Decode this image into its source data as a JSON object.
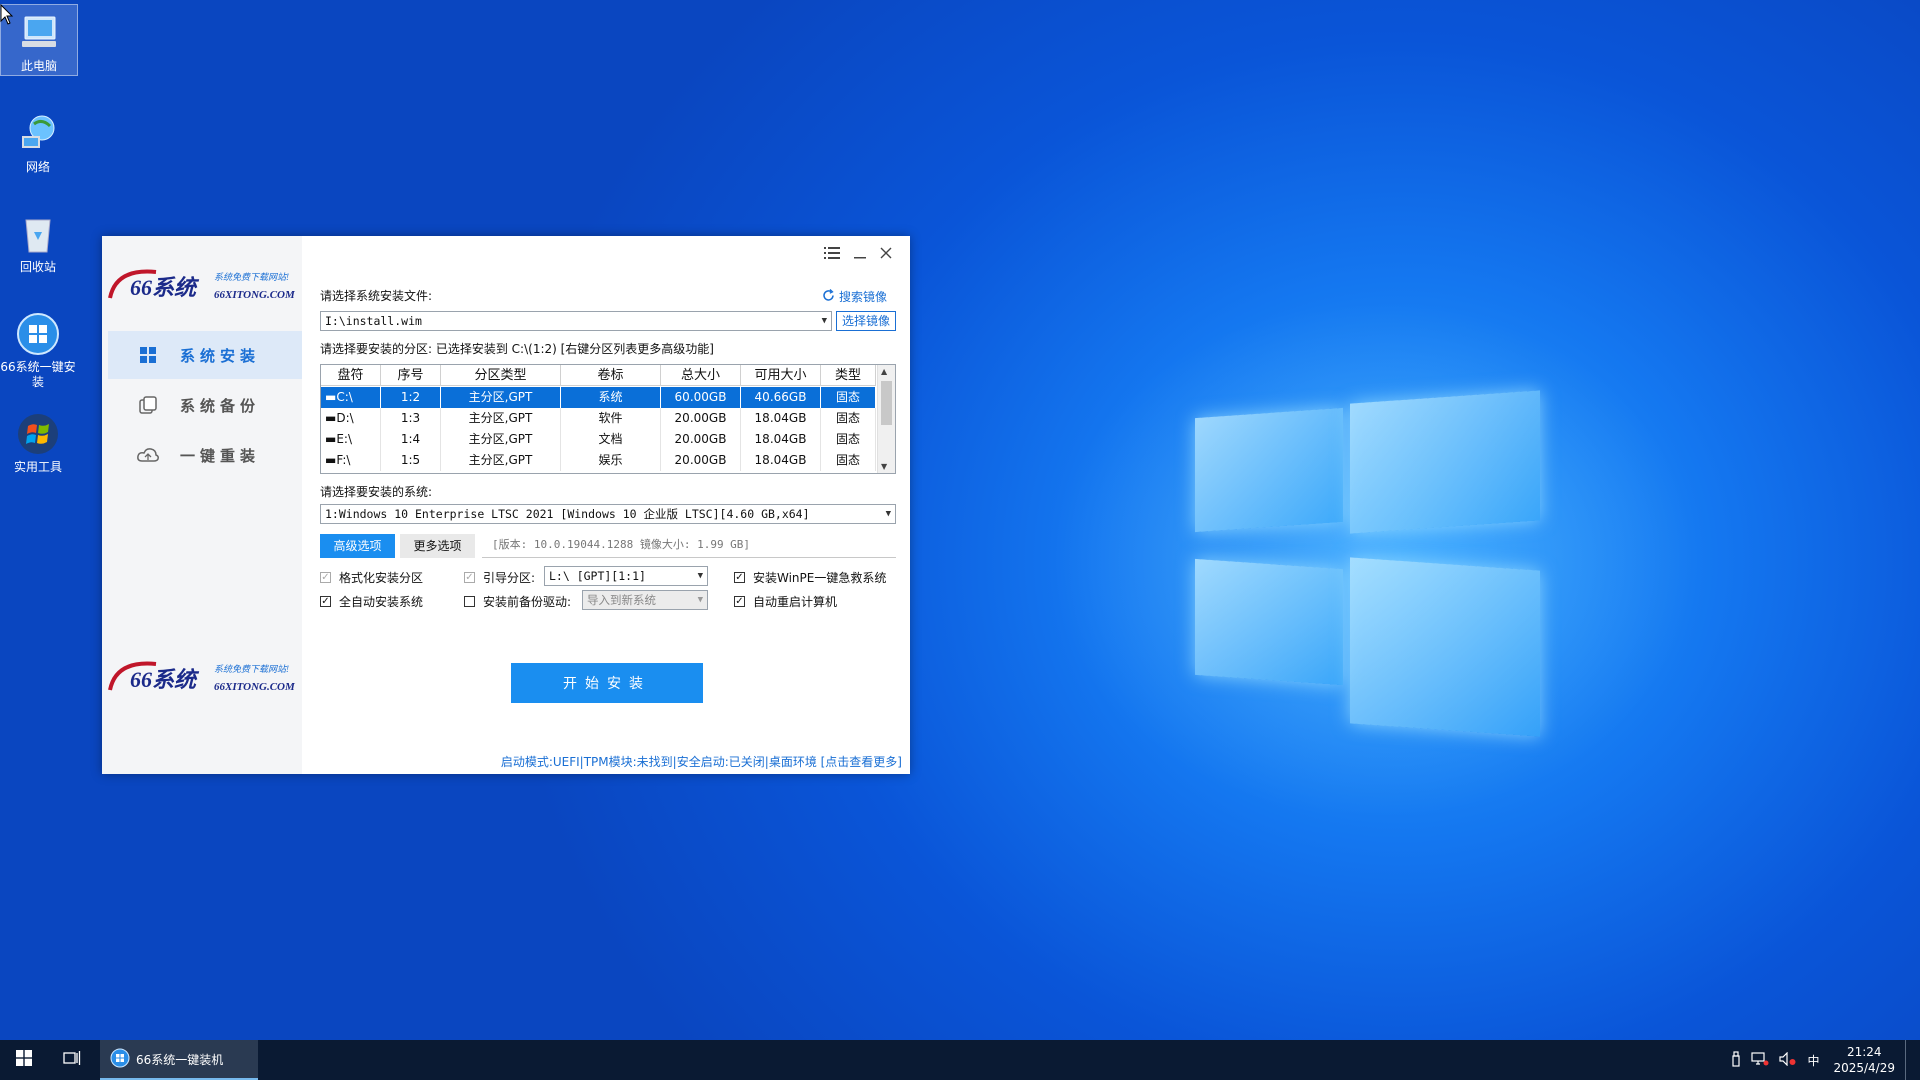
{
  "desktop": {
    "icons": [
      {
        "label": "此电脑",
        "icon": "computer-icon"
      },
      {
        "label": "网络",
        "icon": "network-icon"
      },
      {
        "label": "回收站",
        "icon": "recycle-bin-icon"
      },
      {
        "label": "66系统一键安装",
        "icon": "windows-installer-icon"
      },
      {
        "label": "实用工具",
        "icon": "windows-flag-icon"
      }
    ]
  },
  "window": {
    "sidebar": {
      "nav": [
        {
          "label": "系统安装",
          "icon": "windows-logo-icon"
        },
        {
          "label": "系统备份",
          "icon": "backup-icon"
        },
        {
          "label": "一键重装",
          "icon": "cloud-icon"
        }
      ]
    },
    "image_file": {
      "label": "请选择系统安装文件:",
      "search_link": "搜索镜像",
      "value": "I:\\install.wim",
      "browse_button": "选择镜像"
    },
    "partition": {
      "label": "请选择要安装的分区: 已选择安装到 C:\\(1:2) [右键分区列表更多高级功能]",
      "columns": [
        "盘符",
        "序号",
        "分区类型",
        "卷标",
        "总大小",
        "可用大小",
        "类型"
      ],
      "rows": [
        [
          "C:\\",
          "1:2",
          "主分区,GPT",
          "系统",
          "60.00GB",
          "40.66GB",
          "固态"
        ],
        [
          "D:\\",
          "1:3",
          "主分区,GPT",
          "软件",
          "20.00GB",
          "18.04GB",
          "固态"
        ],
        [
          "E:\\",
          "1:4",
          "主分区,GPT",
          "文档",
          "20.00GB",
          "18.04GB",
          "固态"
        ],
        [
          "F:\\",
          "1:5",
          "主分区,GPT",
          "娱乐",
          "20.00GB",
          "18.04GB",
          "固态"
        ]
      ]
    },
    "system_select": {
      "label": "请选择要安装的系统:",
      "value": "1:Windows 10 Enterprise LTSC 2021 [Windows 10 企业版 LTSC][4.60 GB,x64]"
    },
    "tabs": [
      "高级选项",
      "更多选项"
    ],
    "version_info": "[版本: 10.0.19044.1288 镜像大小: 1.99 GB]",
    "options": {
      "format_partition": "格式化安装分区",
      "boot_partition": "引导分区:",
      "boot_partition_value": "L:\\ [GPT][1:1]",
      "install_winpe": "安装WinPE一键急救系统",
      "auto_install": "全自动安装系统",
      "backup_drivers": "安装前备份驱动:",
      "backup_drivers_value": "导入到新系统",
      "auto_restart": "自动重启计算机"
    },
    "start_button": "开始安装",
    "status_bar": "启动模式:UEFI|TPM模块:未找到|安全启动:已关闭|桌面环境 [点击查看更多]"
  },
  "taskbar": {
    "app_label": "66系统一键装机",
    "ime": "中",
    "time": "21:24",
    "date": "2025/4/29"
  }
}
